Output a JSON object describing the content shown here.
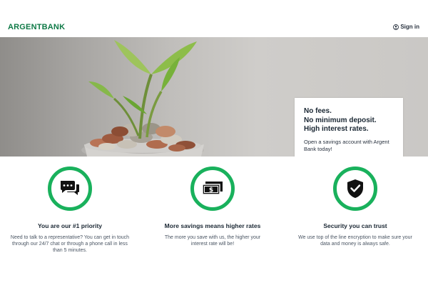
{
  "header": {
    "brand": "ARGENTBANK",
    "signin_label": "Sign in"
  },
  "hero": {
    "headline": [
      "No fees.",
      "No minimum deposit.",
      "High interest rates."
    ],
    "subtext": "Open a savings account with Argent Bank today!"
  },
  "features": [
    {
      "icon": "chat-icon",
      "title": "You are our #1 priority",
      "text": "Need to talk to a representative? You can get in touch through our 24/7 chat or through a phone call in less than 5 minutes."
    },
    {
      "icon": "money-icon",
      "title": "More savings means higher rates",
      "text": "The more you save with us, the higher your interest rate will be!"
    },
    {
      "icon": "shield-icon",
      "title": "Security you can trust",
      "text": "We use top of the line encryption to make sure your data and money is always safe."
    }
  ],
  "colors": {
    "brand": "#0f7a47",
    "accent": "#19b15c"
  }
}
